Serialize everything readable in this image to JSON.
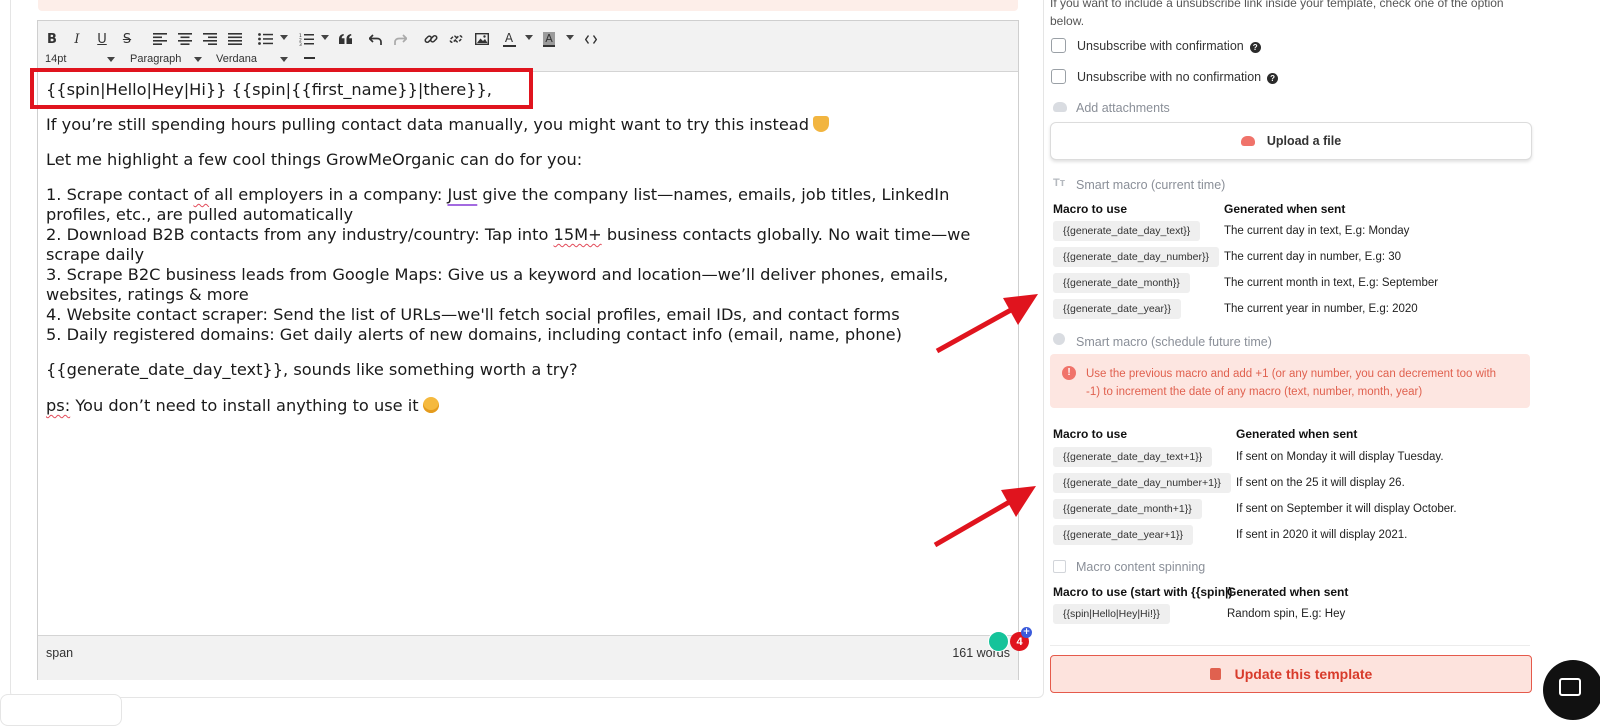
{
  "toolbar": {
    "font_size": "14pt",
    "block_format": "Paragraph",
    "font_family": "Verdana",
    "buttons": [
      "bold",
      "italic",
      "underline",
      "strikethrough",
      "align-left",
      "align-center",
      "align-right",
      "justify",
      "bullet-list",
      "numbered-list",
      "blockquote",
      "undo",
      "redo",
      "link",
      "unlink",
      "image",
      "text-color",
      "background-color",
      "source-code"
    ],
    "bold": "B",
    "italic": "I",
    "underline": "U",
    "strike": "S",
    "text_color": "A",
    "bg_color": "A",
    "code": "<>"
  },
  "editor": {
    "line1": "{{spin|Hello|Hey|Hi}} {{spin|{{first_name}}|there}},",
    "line2": "If you’re still spending hours pulling contact data manually, you might want to try this instead",
    "line3": "Let me highlight a few cool things GrowMeOrganic can do for you:",
    "item1a_1": "1. Scrape contact ",
    "item1a_of": "of",
    "item1a_2": " all employers in a company: ",
    "item1a_just": "Just",
    "item1a_3": " give the company list—names, emails, job titles, LinkedIn",
    "item1b": "profiles, etc., are pulled automatically",
    "item2a_1": "2. Download B2B contacts from any industry/country: Tap into ",
    "item2a_15m": "15M+",
    "item2a_2": " business contacts globally. No wait time—we",
    "item2b": "scrape daily",
    "item3a": "3. Scrape B2C business leads from Google Maps: Give us a keyword and location—we’ll deliver phones, emails,",
    "item3b": "websites, ratings & more",
    "item4": "4. Website contact scraper: Send the list of URLs—we'll fetch social profiles, email IDs, and contact forms",
    "item5": "5. Daily registered domains: Get daily alerts of new domains, including contact info (email, name, phone)",
    "line_macro": "{{generate_date_day_text}}, sounds like something worth a try?",
    "ps_label": "ps:",
    "ps_text": " You don’t need to install anything to use it"
  },
  "statusbar": {
    "path": "span",
    "word_count": "161 words"
  },
  "grammarly": {
    "count": "4"
  },
  "right": {
    "unsub_intro_1": "If you want to include a unsubscribe link inside your template, check one of the option",
    "unsub_intro_2": "below.",
    "unsub_confirm": "Unsubscribe with confirmation",
    "unsub_no_confirm": "Unsubscribe with no confirmation",
    "attachments_label": "Add attachments",
    "upload_label": "Upload a file",
    "smart_current_label": "Smart macro (current time)",
    "col_macro": "Macro to use",
    "col_generated": "Generated when sent",
    "current_rows": [
      {
        "macro": "{{generate_date_day_text}}",
        "desc": "The current day in text, E.g: Monday"
      },
      {
        "macro": "{{generate_date_day_number}}",
        "desc": "The current day in number, E.g: 30"
      },
      {
        "macro": "{{generate_date_month}}",
        "desc": "The current month in text, E.g: September"
      },
      {
        "macro": "{{generate_date_year}}",
        "desc": "The current year in number, E.g: 2020"
      }
    ],
    "smart_future_label": "Smart macro (schedule future time)",
    "future_alert_1": "Use the previous macro and add +1 (or any number, you can decrement too with",
    "future_alert_2": "-1) to increment the date of any macro (text, number, month, year)",
    "future_rows": [
      {
        "macro": "{{generate_date_day_text+1}}",
        "desc": "If sent on Monday it will display Tuesday."
      },
      {
        "macro": "{{generate_date_day_number+1}}",
        "desc": "If sent on the 25 it will display 26."
      },
      {
        "macro": "{{generate_date_month+1}}",
        "desc": "If sent on September it will display October."
      },
      {
        "macro": "{{generate_date_year+1}}",
        "desc": "If sent in 2020 it will display 2021."
      }
    ],
    "spin_label": "Macro content spinning",
    "spin_col_macro": "Macro to use (start with {{spin|)",
    "spin_col_generated": "Generated when sent",
    "spin_macro": "{{spin|Hello|Hey|Hi!}}",
    "spin_desc": "Random spin, E.g: Hey",
    "update_label": "Update this template"
  },
  "colors": {
    "accent_red": "#e0141e",
    "update_text": "#d83b2b",
    "alert_bg": "#fde6e1"
  }
}
